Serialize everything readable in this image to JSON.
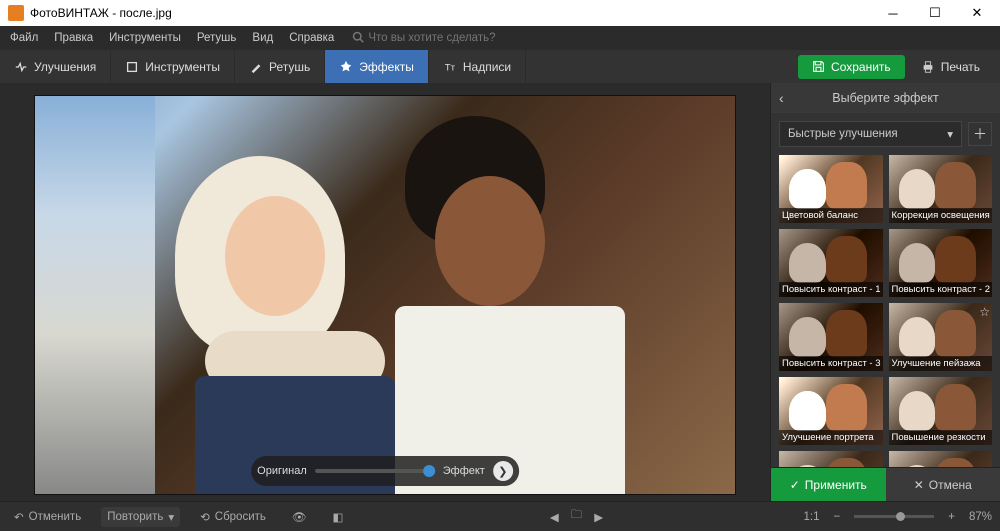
{
  "title": "ФотоВИНТАЖ - после.jpg",
  "menu": {
    "file": "Файл",
    "edit": "Правка",
    "instruments": "Инструменты",
    "retouch": "Ретушь",
    "view": "Вид",
    "help": "Справка",
    "search_placeholder": "Что вы хотите сделать?"
  },
  "tabs": {
    "enhance": "Улучшения",
    "tools": "Инструменты",
    "retouch": "Ретушь",
    "effects": "Эффекты",
    "captions": "Надписи"
  },
  "actions": {
    "save": "Сохранить",
    "print": "Печать"
  },
  "compare": {
    "original": "Оригинал",
    "effect": "Эффект"
  },
  "panel": {
    "title": "Выберите эффект",
    "dropdown": "Быстрые улучшения",
    "thumbs": [
      "Цветовой баланс",
      "Коррекция освещения",
      "Повысить контраст - 1",
      "Повысить контраст - 2",
      "Повысить контраст - 3",
      "Улучшение пейзажа",
      "Улучшение портрета",
      "Повышение резкости"
    ],
    "apply": "Применить",
    "cancel": "Отмена"
  },
  "status": {
    "undo": "Отменить",
    "redo": "Повторить",
    "reset": "Сбросить",
    "ratio": "1:1",
    "zoom": "87%"
  }
}
